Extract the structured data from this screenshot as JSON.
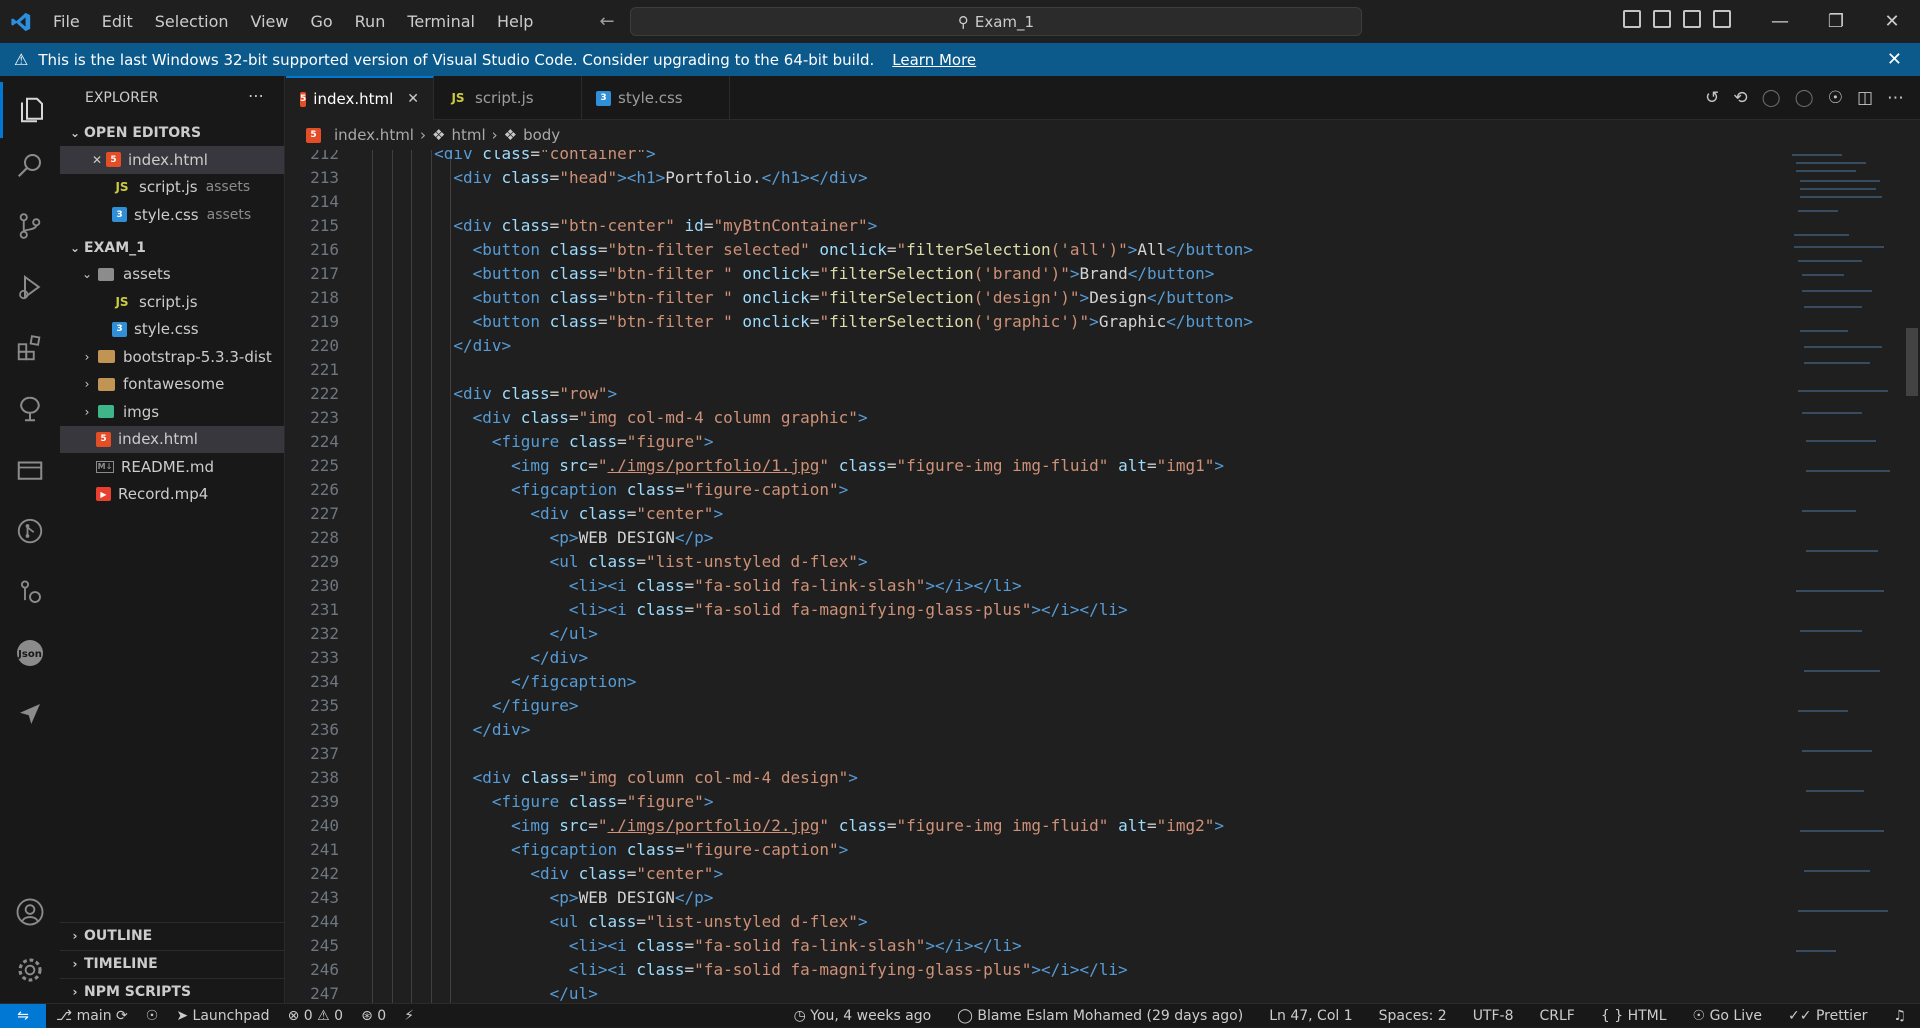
{
  "titlebar": {
    "menu": [
      "File",
      "Edit",
      "Selection",
      "View",
      "Go",
      "Run",
      "Terminal",
      "Help"
    ],
    "search": "Exam_1"
  },
  "banner": {
    "message": "This is the last Windows 32-bit supported version of Visual Studio Code. Consider upgrading to the 64-bit build.",
    "link": "Learn More"
  },
  "sidebar": {
    "title": "EXPLORER",
    "open_editors_label": "OPEN EDITORS",
    "open_editors": [
      {
        "name": "index.html",
        "sub": ""
      },
      {
        "name": "script.js",
        "sub": "assets"
      },
      {
        "name": "style.css",
        "sub": "assets"
      }
    ],
    "project_label": "EXAM_1",
    "tree": {
      "assets": "assets",
      "assets_script": "script.js",
      "assets_style": "style.css",
      "bootstrap": "bootstrap-5.3.3-dist",
      "fontawesome": "fontawesome",
      "imgs": "imgs",
      "index": "index.html",
      "readme": "README.md",
      "record": "Record.mp4"
    },
    "outline": "OUTLINE",
    "timeline": "TIMELINE",
    "npm": "NPM SCRIPTS"
  },
  "tabs": [
    {
      "label": "index.html"
    },
    {
      "label": "script.js"
    },
    {
      "label": "style.css"
    }
  ],
  "breadcrumbs": [
    "index.html",
    "html",
    "body"
  ],
  "code": {
    "l212": "212",
    "l213": "213",
    "l214": "214",
    "l215": "215",
    "l216": "216",
    "l217": "217",
    "l218": "218",
    "l219": "219",
    "l220": "220",
    "l221": "221",
    "l222": "222",
    "l223": "223",
    "l224": "224",
    "l225": "225",
    "l226": "226",
    "l227": "227",
    "l228": "228",
    "l229": "229",
    "l230": "230",
    "l231": "231",
    "l232": "232",
    "l233": "233",
    "l234": "234",
    "l235": "235",
    "l236": "236",
    "l237": "237",
    "l238": "238",
    "l239": "239",
    "l240": "240",
    "l241": "241",
    "l242": "242",
    "l243": "243",
    "l244": "244",
    "l245": "245",
    "l246": "246",
    "l247": "247"
  },
  "statusbar": {
    "branch": "main",
    "launchpad": "Launchpad",
    "errors": "0",
    "warnings": "0",
    "ports": "0",
    "blame_time": "You, 4 weeks ago",
    "blame": "Blame Eslam Mohamed (29 days ago)",
    "position": "Ln 47, Col 1",
    "spaces": "Spaces: 2",
    "encoding": "UTF-8",
    "eol": "CRLF",
    "language": "HTML",
    "golive": "Go Live",
    "prettier": "Prettier"
  },
  "colors": {
    "accent": "#0078d4",
    "banner": "#0c5a8c"
  }
}
